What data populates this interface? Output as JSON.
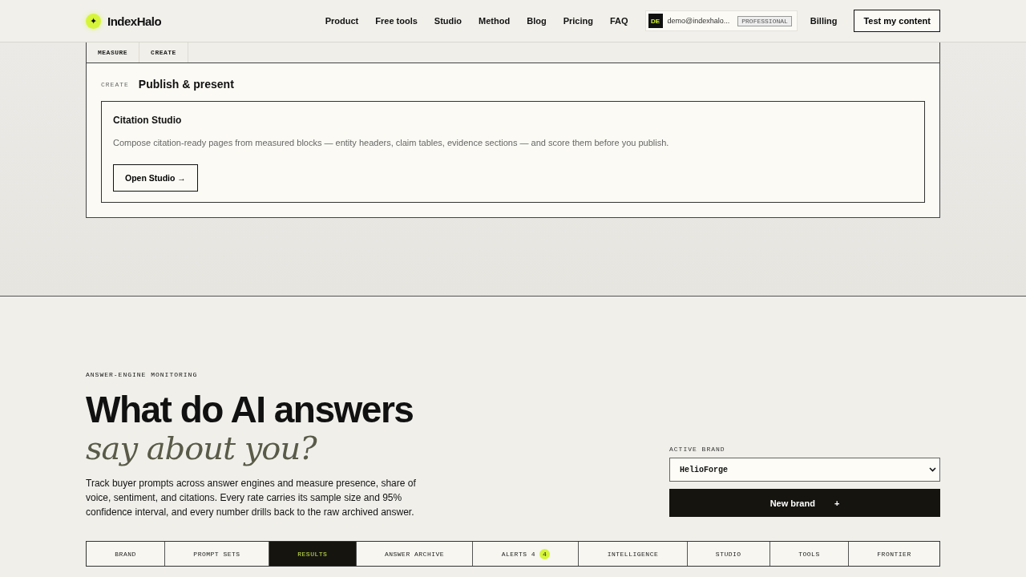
{
  "header": {
    "logo": "IndexHalo",
    "logo_mark": "✦",
    "nav": [
      "Product",
      "Free tools",
      "Studio",
      "Method",
      "Blog",
      "Pricing",
      "FAQ"
    ],
    "account": {
      "initials": "DE",
      "email": "demo@indexhalo...",
      "plan": "PROFESSIONAL"
    },
    "billing": "Billing",
    "cta": "Test my content"
  },
  "panel": {
    "tabs": [
      "MEASURE",
      "CREATE"
    ],
    "eyebrow": "CREATE",
    "title": "Publish & present",
    "card": {
      "title": "Citation Studio",
      "description": "Compose citation-ready pages from measured blocks — entity headers, claim tables, evidence sections — and score them before you publish.",
      "button": "Open Studio →"
    }
  },
  "hero": {
    "eyebrow": "ANSWER-ENGINE MONITORING",
    "headline": "What do AI answers",
    "headline_italic": "say about you?",
    "body": "Track buyer prompts across answer engines and measure presence, share of voice, sentiment, and citations. Every rate carries its sample size and 95% confidence interval, and every number drills back to the raw archived answer.",
    "brand_label": "ACTIVE BRAND",
    "brand_value": "HelioForge",
    "new_brand": "New brand",
    "new_brand_icon": "+"
  },
  "tabs": [
    {
      "label": "BRAND",
      "selected": false
    },
    {
      "label": "PROMPT SETS",
      "selected": false
    },
    {
      "label": "RESULTS",
      "selected": true
    },
    {
      "label": "ANSWER ARCHIVE",
      "selected": false
    },
    {
      "label": "ALERTS 4",
      "badge": "4",
      "selected": false
    },
    {
      "label": "INTELLIGENCE",
      "selected": false
    },
    {
      "label": "STUDIO",
      "selected": false
    },
    {
      "label": "TOOLS",
      "selected": false
    },
    {
      "label": "FRONTIER",
      "selected": false
    }
  ]
}
